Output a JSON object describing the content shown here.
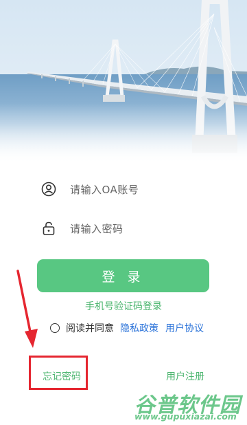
{
  "login": {
    "account_placeholder": "请输入OA账号",
    "password_placeholder": "请输入密码",
    "login_button": "登 录",
    "sms_login": "手机号验证码登录",
    "agree_text": "阅读并同意",
    "privacy_policy": "隐私政策",
    "user_agreement": "用户协议",
    "forgot_password": "忘记密码",
    "register": "用户注册"
  },
  "watermark": {
    "title": "谷普软件园",
    "url": "www.gupuxiazai.com"
  },
  "icons": {
    "account": "user-icon",
    "password": "lock-icon"
  },
  "colors": {
    "accent_green": "#58c782",
    "link_green": "#4bb56e",
    "link_blue": "#2b73d9",
    "annotation_red": "#e52630"
  }
}
